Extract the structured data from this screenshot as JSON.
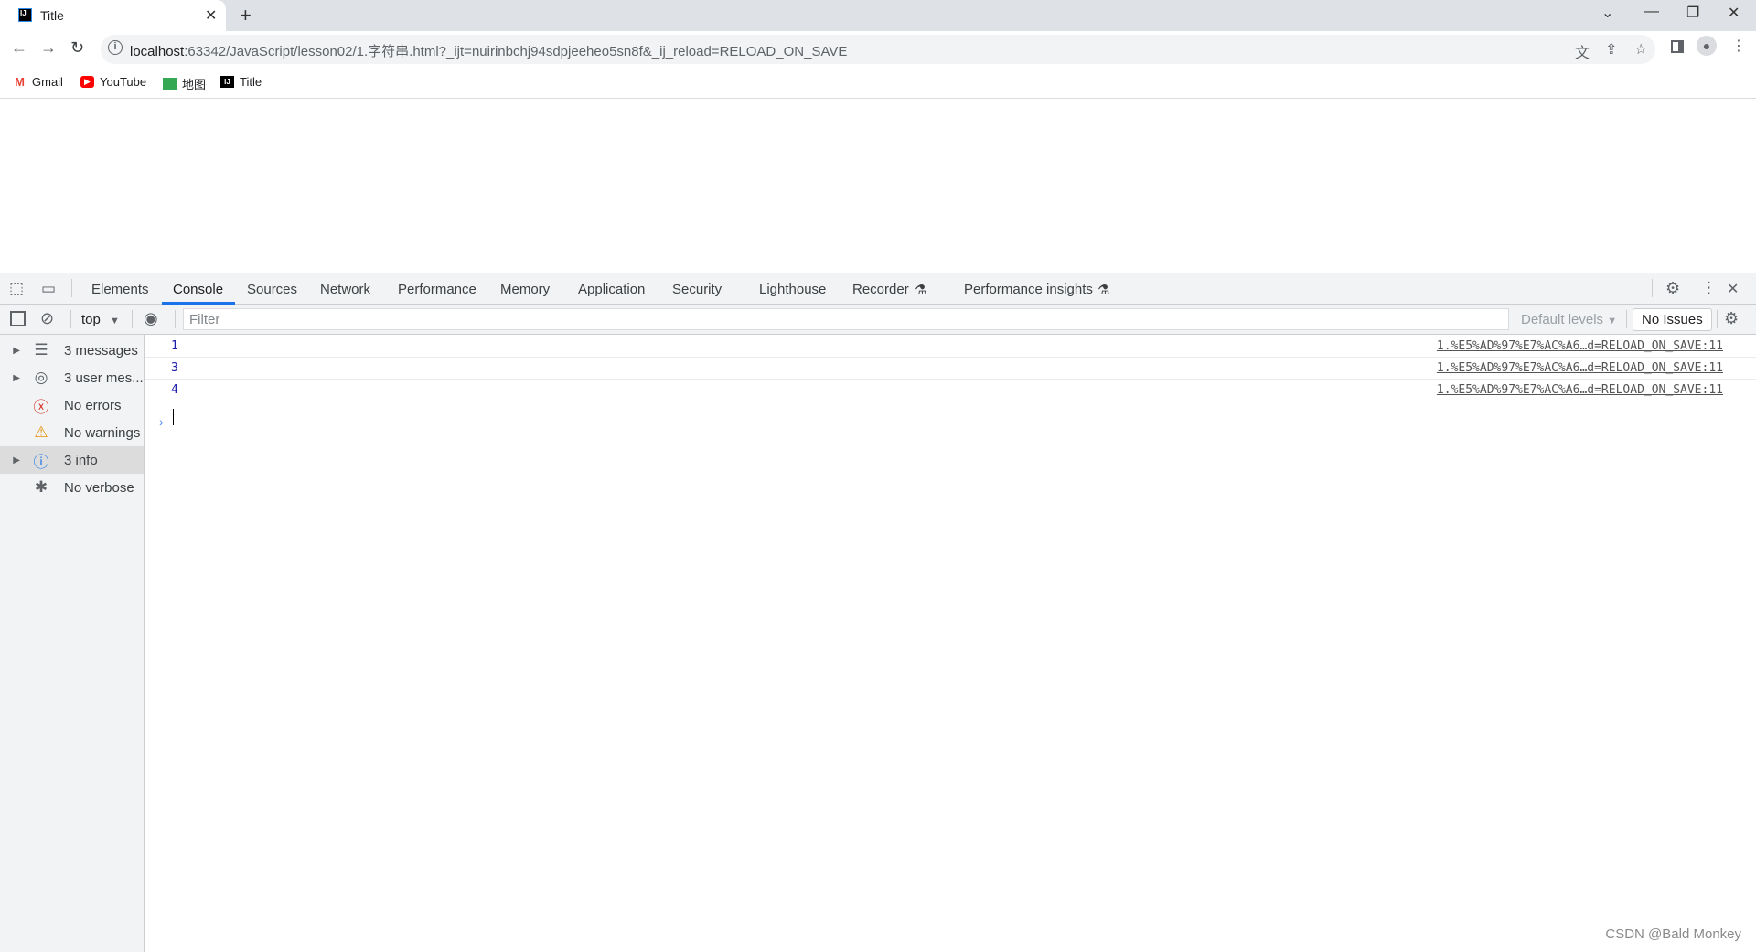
{
  "browser": {
    "tab_title": "Title",
    "tab_favicon": "IJ",
    "url_host": "localhost",
    "url_rest": ":63342/JavaScript/lesson02/1.字符串.html?_ijt=nuirinbchj94sdpjeeheo5sn8f&_ij_reload=RELOAD_ON_SAVE",
    "bookmarks": [
      {
        "label": "Gmail",
        "icon": "gmail-icon",
        "color": "#ea4335"
      },
      {
        "label": "YouTube",
        "icon": "youtube-icon",
        "color": "#ff0000"
      },
      {
        "label": "地图",
        "icon": "maps-icon",
        "color": "#34a853"
      },
      {
        "label": "Title",
        "icon": "intellij-icon",
        "color": "#000000"
      }
    ]
  },
  "devtools": {
    "tabs": [
      "Elements",
      "Console",
      "Sources",
      "Network",
      "Performance",
      "Memory",
      "Application",
      "Security",
      "Lighthouse",
      "Recorder",
      "Performance insights"
    ],
    "active_tab": "Console",
    "context": "top",
    "filter_placeholder": "Filter",
    "levels": "Default levels",
    "issues": "No Issues",
    "sidebar": [
      {
        "label": "3 messages",
        "icon": "list-icon",
        "expandable": true
      },
      {
        "label": "3 user mes...",
        "icon": "user-icon",
        "expandable": true
      },
      {
        "label": "No errors",
        "icon": "error-icon",
        "expandable": false
      },
      {
        "label": "No warnings",
        "icon": "warning-icon",
        "expandable": false
      },
      {
        "label": "3 info",
        "icon": "info-icon",
        "expandable": true,
        "selected": true
      },
      {
        "label": "No verbose",
        "icon": "bug-icon",
        "expandable": false
      }
    ],
    "messages": [
      {
        "value": "1",
        "source": "1.%E5%AD%97%E7%AC%A6…d=RELOAD_ON_SAVE:11"
      },
      {
        "value": "3",
        "source": "1.%E5%AD%97%E7%AC%A6…d=RELOAD_ON_SAVE:11"
      },
      {
        "value": "4",
        "source": "1.%E5%AD%97%E7%AC%A6…d=RELOAD_ON_SAVE:11"
      }
    ]
  },
  "watermark": "CSDN @Bald Monkey"
}
